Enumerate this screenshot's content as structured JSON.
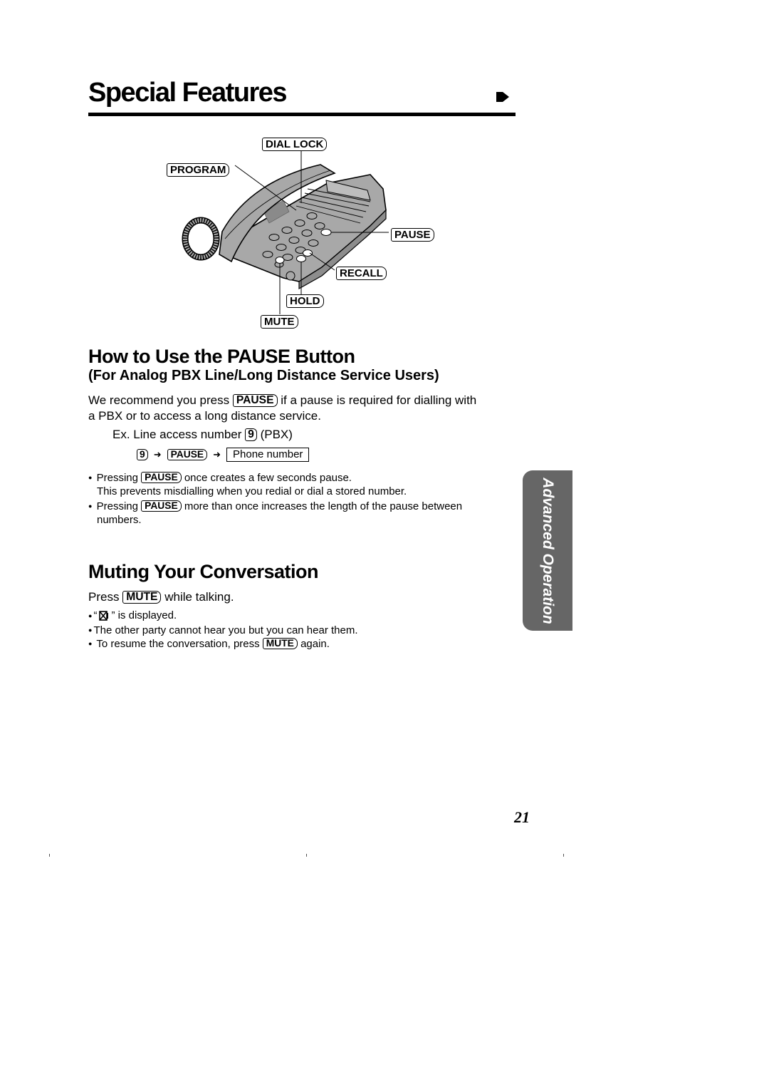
{
  "header": {
    "title": "Special Features",
    "continue_icon": "arrow-right-icon"
  },
  "diagram": {
    "callouts": {
      "dial_lock": "DIAL LOCK",
      "program": "PROGRAM",
      "pause": "PAUSE",
      "recall": "RECALL",
      "hold": "HOLD",
      "mute": "MUTE"
    },
    "colors": {
      "body": "#a8a8a8",
      "outline": "#000000"
    }
  },
  "pause_section": {
    "heading": "How to Use the PAUSE Button",
    "subheading": "(For Analog PBX Line/Long Distance Service Users)",
    "recommend_prefix": "We recommend you press",
    "recommend_key": "PAUSE",
    "recommend_suffix": "if a pause is required for dialling with",
    "recommend_line2": "a PBX or to access a long distance service.",
    "example_prefix": "Ex. Line access number",
    "example_key": "9",
    "example_suffix": "(PBX)",
    "sequence": {
      "step1_key": "9",
      "step2_key": "PAUSE",
      "step3_box": "Phone number",
      "arrow_icon": "arrow-right-icon"
    },
    "bullets": [
      {
        "prefix": "Pressing",
        "key": "PAUSE",
        "suffix": "once creates a few seconds pause.",
        "continuation": "This prevents misdialling when you redial or dial a stored number."
      },
      {
        "prefix": "Pressing",
        "key": "PAUSE",
        "suffix": "more than once increases the length of the pause between",
        "continuation": "numbers."
      }
    ]
  },
  "mute_section": {
    "heading": "Muting Your Conversation",
    "press_prefix": "Press",
    "press_key": "MUTE",
    "press_suffix": "while talking.",
    "bullets": {
      "displayed_open_quote": "“",
      "displayed_icon": "mute-icon",
      "displayed_suffix": "” is displayed.",
      "other_party": "The other party cannot hear you but you can hear them.",
      "resume_prefix": "To resume the conversation, press",
      "resume_key": "MUTE",
      "resume_suffix": "again."
    }
  },
  "side_tab": {
    "label": "Advanced Operation",
    "background": "#666666"
  },
  "page_number": "21"
}
